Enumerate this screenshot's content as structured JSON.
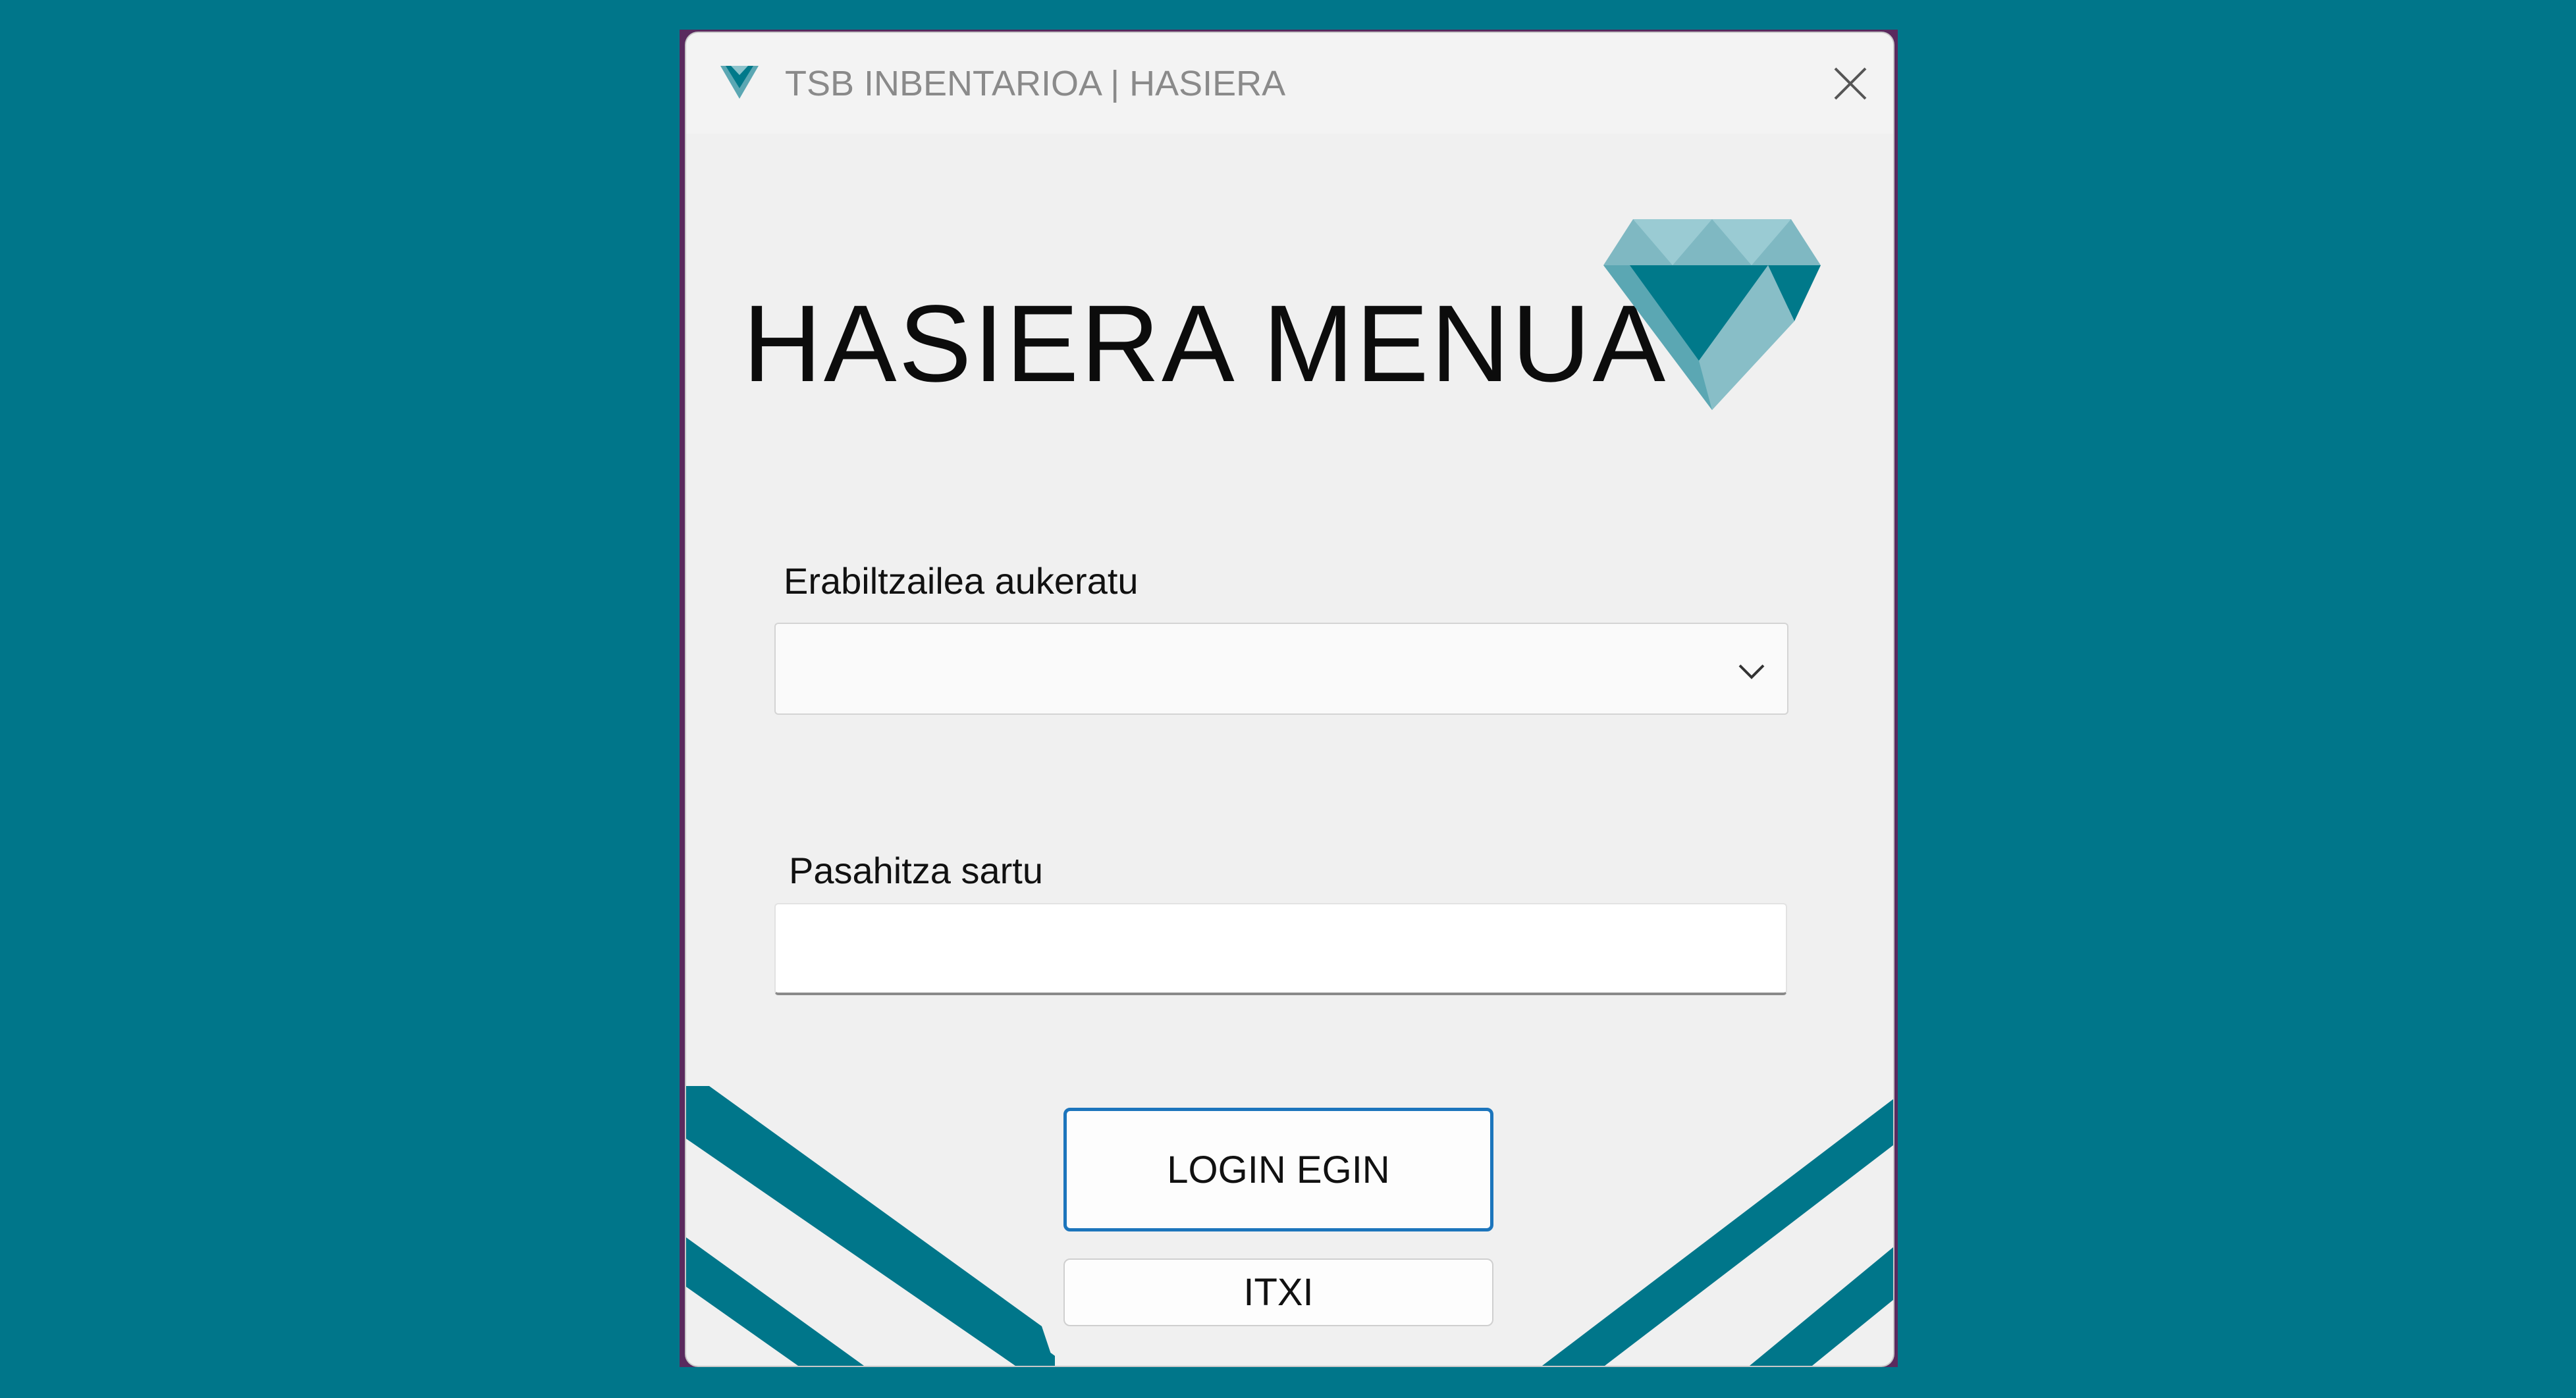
{
  "window": {
    "title": "TSB INBENTARIOA | HASIERA"
  },
  "main": {
    "heading": "HASIERA MENUA"
  },
  "user_select": {
    "label": "Erabiltzailea aukeratu",
    "value": ""
  },
  "password": {
    "label": "Pasahitza sartu",
    "value": ""
  },
  "buttons": {
    "login": "LOGIN EGIN",
    "close": "ITXI"
  },
  "icons": {
    "app": "diamond-logo-icon",
    "close": "close-icon",
    "dropdown": "chevron-down-icon"
  },
  "colors": {
    "background": "#00768A",
    "accent_stripes": "#00768A",
    "logo_dark": "#00798A",
    "logo_light": "#5BA7B3",
    "login_border": "#1C75BC"
  }
}
